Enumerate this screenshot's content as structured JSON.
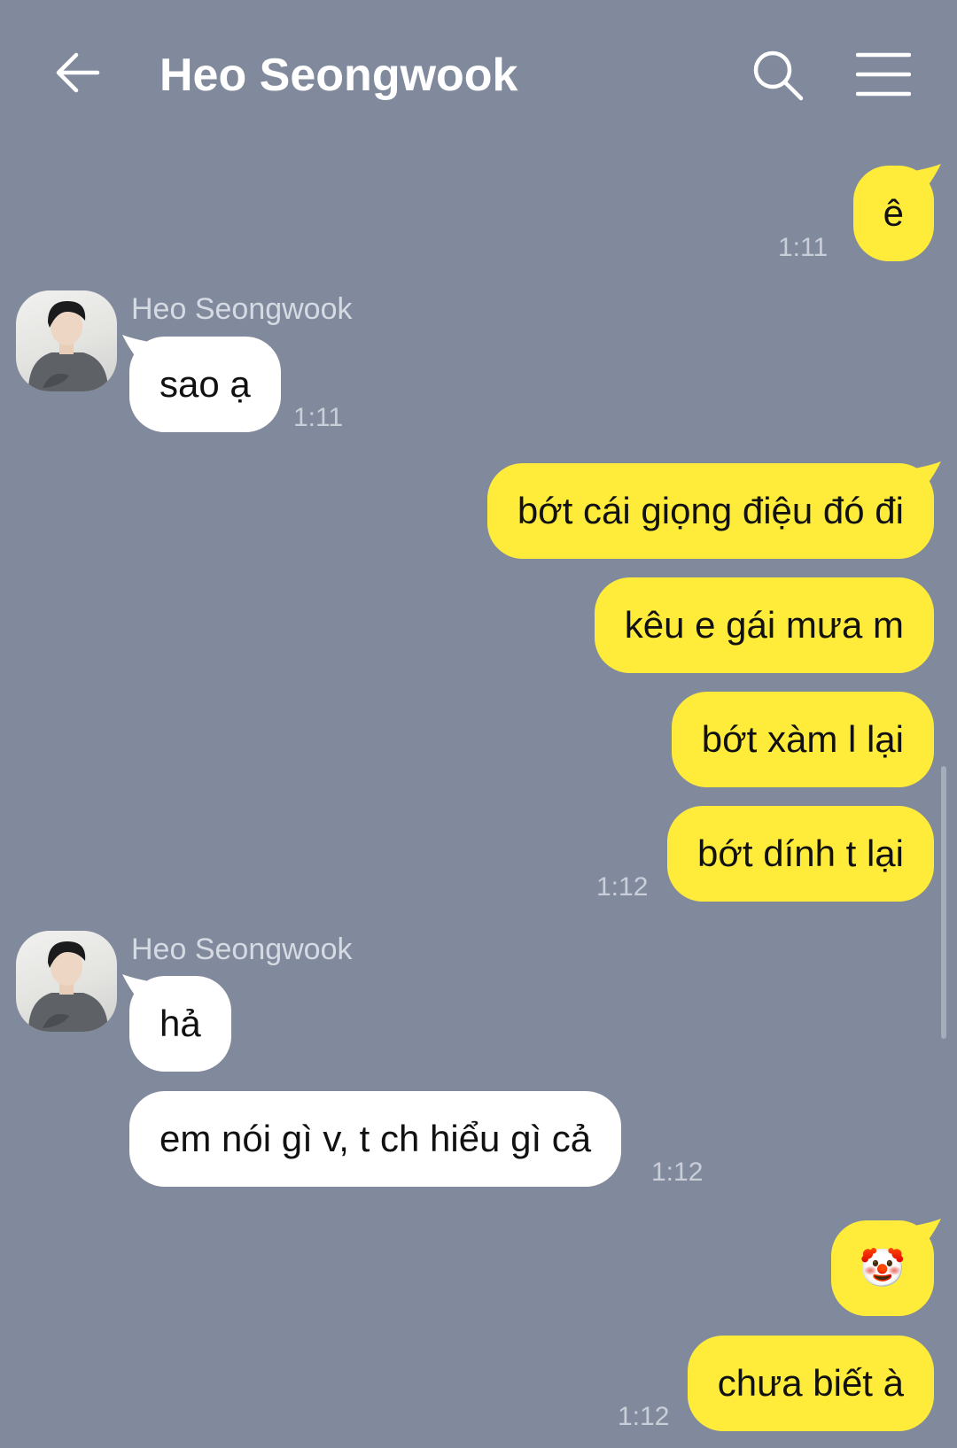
{
  "header": {
    "title": "Heo Seongwook",
    "back_icon": "arrow-left-icon",
    "search_icon": "search-icon",
    "menu_icon": "menu-icon"
  },
  "colors": {
    "background": "#818a9c",
    "my_bubble": "#ffec3a",
    "their_bubble": "#ffffff"
  },
  "messages": [
    {
      "from": "me",
      "text": "ê",
      "time": "1:11"
    },
    {
      "from": "them",
      "sender": "Heo Seongwook",
      "text": "sao ạ",
      "time": "1:11"
    },
    {
      "from": "me",
      "text": "bớt cái giọng điệu đó đi"
    },
    {
      "from": "me",
      "text": "kêu e gái mưa m"
    },
    {
      "from": "me",
      "text": "bớt xàm l lại"
    },
    {
      "from": "me",
      "text": "bớt dính t lại",
      "time": "1:12"
    },
    {
      "from": "them",
      "sender": "Heo Seongwook",
      "text": "hả"
    },
    {
      "from": "them",
      "text": "em nói gì v, t ch hiểu gì cả",
      "time": "1:12"
    },
    {
      "from": "me",
      "text": "🤡"
    },
    {
      "from": "me",
      "text": "chưa biết à",
      "time": "1:12"
    }
  ]
}
